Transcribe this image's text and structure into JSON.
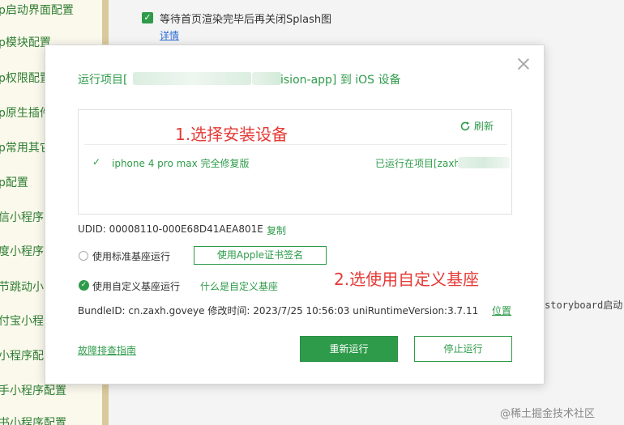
{
  "sidebar": {
    "items": [
      "p启动界面配置",
      "p模块配置",
      "p权限配置",
      "p原生插件",
      "p常用其它",
      "p配置",
      "信小程序",
      "度小程序",
      "节跳动小",
      "付宝小程",
      "小程序配",
      "手小程序配置",
      "书小程序配置"
    ]
  },
  "background": {
    "splash_option_label": "等待首页渲染完毕后再关闭Splash图",
    "detail_link": "详情",
    "storyboard_text": "storyboard启动",
    "watermark": "@稀土掘金技术社区"
  },
  "dialog": {
    "title_prefix": "运行项目[",
    "title_suffix": "ision-app] 到 iOS 设备",
    "refresh_label": "刷新",
    "device": {
      "check_mark": "✓",
      "name": "iphone 4 pro max 完全修复版",
      "running_status": "已运行在项目[zaxh"
    },
    "udid_text": "UDID: 00008110-000E68D41AEA801E",
    "copy_link": "复制",
    "option_standard": "使用标准基座运行",
    "apple_sign_button": "使用Apple证书签名",
    "option_custom": "使用自定义基座运行",
    "custom_base_link": "什么是自定义基座",
    "bundle_info": "BundleID: cn.zaxh.goveye  修改时间: 2023/7/25 10:56:03  uniRuntimeVersion:3.7.11",
    "location_link": "位置",
    "troubleshoot_link": "故障排查指南",
    "rerun_button": "重新运行",
    "stop_button": "停止运行"
  },
  "annotations": {
    "step1": "1.选择安装设备",
    "step2": "2.选使用自定义基座"
  },
  "colors": {
    "accent_green": "#2e9b4a",
    "annotation_red": "#e53935",
    "sidebar_bg": "#fbf9ec"
  }
}
